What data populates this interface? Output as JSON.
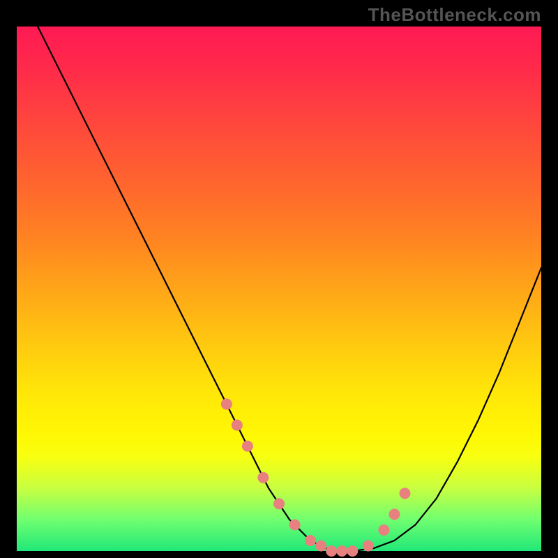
{
  "watermark": "TheBottleneck.com",
  "chart_data": {
    "type": "line",
    "title": "",
    "xlabel": "",
    "ylabel": "",
    "xlim": [
      0,
      100
    ],
    "ylim": [
      0,
      100
    ],
    "series": [
      {
        "name": "curve",
        "x": [
          4,
          8,
          12,
          16,
          20,
          24,
          28,
          32,
          36,
          40,
          44,
          48,
          52,
          56,
          60,
          64,
          68,
          72,
          76,
          80,
          84,
          88,
          92,
          96,
          100
        ],
        "values": [
          100,
          92,
          84,
          76,
          68,
          60,
          52,
          44,
          36,
          28,
          20,
          12,
          6,
          2,
          0,
          0,
          0.5,
          2,
          5,
          10,
          17,
          25,
          34,
          44,
          54
        ]
      }
    ],
    "markers": {
      "name": "highlight-dots",
      "color": "#e88080",
      "x": [
        40,
        42,
        44,
        47,
        50,
        53,
        56,
        58,
        60,
        62,
        64,
        67,
        70,
        72,
        74
      ],
      "values": [
        28,
        24,
        20,
        14,
        9,
        5,
        2,
        1,
        0,
        0,
        0,
        1,
        4,
        7,
        11
      ]
    }
  }
}
